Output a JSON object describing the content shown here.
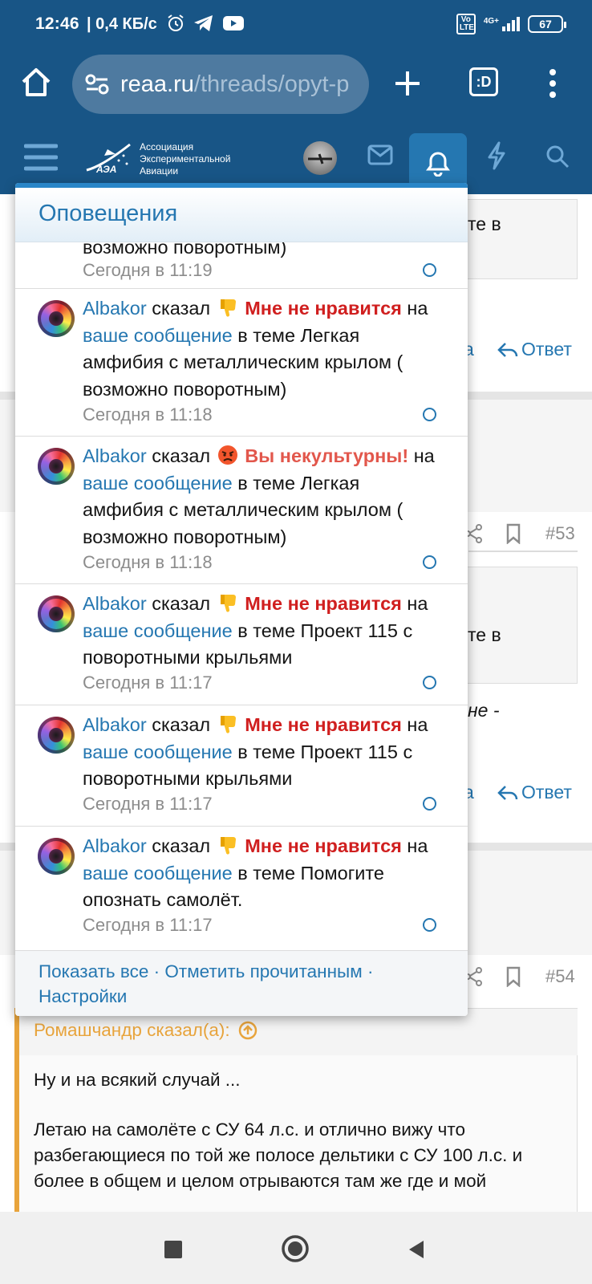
{
  "status_bar": {
    "time": "12:46",
    "speed": "| 0,4 КБ/с",
    "network_label": "4G+",
    "volte_label": "Vo LTE",
    "battery": "67"
  },
  "browser": {
    "domain": "reaa.ru",
    "path": "/threads/opyt-p",
    "tabs_count": ":D"
  },
  "site": {
    "logo_line1": "Ассоциация",
    "logo_line2": "Экспериментальной",
    "logo_line3": "Авиации",
    "logo_mark": "АЭА"
  },
  "background": {
    "partial_text1": "те в",
    "reply_label_1": "Ответ",
    "link_partial_1": "а",
    "post_num_1": "#53",
    "partial_text2": "те в",
    "partial_text3": "не -",
    "reply_label_2": "Ответ",
    "link_partial_2": "а",
    "post_num_2": "#54",
    "quote_author": "Ромашчандр сказал(а):",
    "quote_text": "Ну и на всякий случай ...",
    "post_text": "Летаю на самолёте с СУ 64 л.с. и отлично вижу что разбегающиеся по той же полосе дельтики с СУ 100 л.с. и более в общем и целом отрываются там же где и мой"
  },
  "notifications": {
    "title": "Оповещения",
    "partial_top": {
      "text": "возможно поворотным)",
      "time": "Сегодня в 11:19"
    },
    "items": [
      {
        "user": "Albakor",
        "said": "сказал",
        "emoji": "thumbs-down",
        "reaction": "Мне не нравится",
        "on": "на",
        "link": "ваше сообщение",
        "rest": "в теме Легкая амфибия с металлическим крылом ( возможно поворотным)",
        "time": "Сегодня в 11:18"
      },
      {
        "user": "Albakor",
        "said": "сказал",
        "emoji": "angry-face",
        "reaction": "Вы некультурны!",
        "on": "на",
        "link": "ваше сообщение",
        "rest": "в теме Легкая амфибия с металлическим крылом ( возможно поворотным)",
        "time": "Сегодня в 11:18"
      },
      {
        "user": "Albakor",
        "said": "сказал",
        "emoji": "thumbs-down",
        "reaction": "Мне не нравится",
        "on": "на",
        "link": "ваше сообщение",
        "rest": "в теме Проект 115 с поворотными крыльями",
        "time": "Сегодня в 11:17"
      },
      {
        "user": "Albakor",
        "said": "сказал",
        "emoji": "thumbs-down",
        "reaction": "Мне не нравится",
        "on": "на",
        "link": "ваше сообщение",
        "rest": "в теме Проект 115 с поворотными крыльями",
        "time": "Сегодня в 11:17"
      },
      {
        "user": "Albakor",
        "said": "сказал",
        "emoji": "thumbs-down",
        "reaction": "Мне не нравится",
        "on": "на",
        "link": "ваше сообщение",
        "rest": "в теме Помогите опознать самолёт.",
        "time": "Сегодня в 11:17"
      }
    ],
    "footer": {
      "show_all": "Показать все",
      "mark_read": "Отметить прочитанным",
      "settings": "Настройки",
      "separator": "·"
    }
  },
  "colors": {
    "header_bg": "#185586",
    "link": "#2577b1",
    "reaction_red": "#d01f1f",
    "quote_orange": "#e8a43c"
  }
}
